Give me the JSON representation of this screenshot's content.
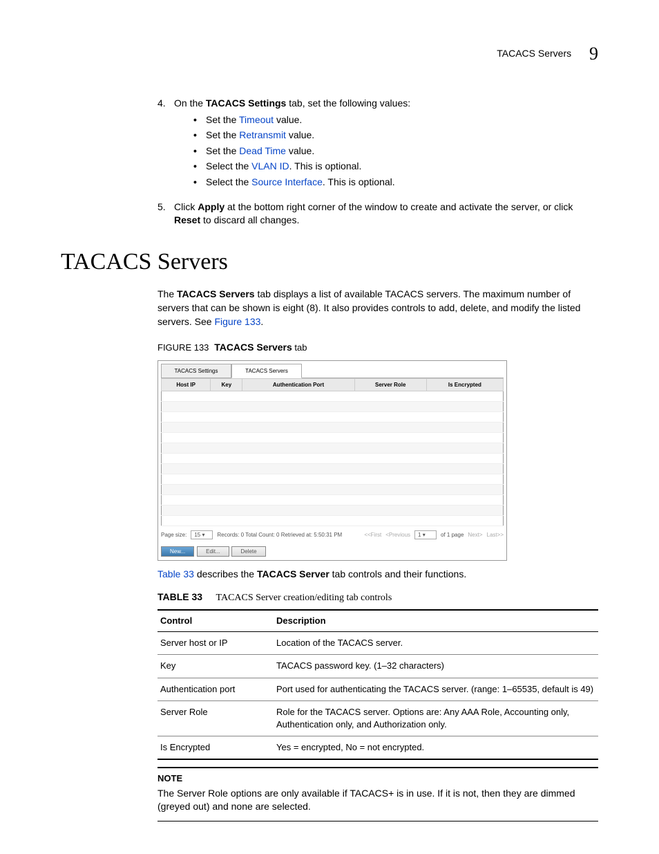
{
  "header": {
    "running_title": "TACACS Servers",
    "chapter_number": "9"
  },
  "steps": [
    {
      "num": "4.",
      "intro_before": "On the ",
      "bold1": "TACACS Settings",
      "intro_after": " tab, set the following values:",
      "bullets": [
        {
          "pre": "Set the ",
          "link": "Timeout",
          "post": " value."
        },
        {
          "pre": "Set the ",
          "link": "Retransmit",
          "post": " value."
        },
        {
          "pre": "Set the ",
          "link": "Dead Time",
          "post": " value."
        },
        {
          "pre": "Select the ",
          "link": "VLAN ID",
          "post": ". This is optional."
        },
        {
          "pre": "Select the ",
          "link": "Source Interface",
          "post": ". This is optional."
        }
      ]
    },
    {
      "num": "5.",
      "text_parts": [
        "Click ",
        "Apply",
        " at the bottom right corner of the window to create and activate the server, or click ",
        "Reset",
        " to discard all changes."
      ]
    }
  ],
  "section_title": "TACACS Servers",
  "intro_para": {
    "pre": "The ",
    "bold": "TACACS Servers",
    "mid": " tab displays a list of available TACACS servers. The maximum number of servers that can be shown is eight (8). It also provides controls to add, delete, and modify the listed servers. See ",
    "link": "Figure 133",
    "post": "."
  },
  "figure": {
    "label": "FIGURE 133",
    "title": "TACACS Servers",
    "title_suffix": " tab",
    "tabs": [
      "TACACS Settings",
      "TACACS Servers"
    ],
    "columns": [
      "Host IP",
      "Key",
      "Authentication Port",
      "Server Role",
      "Is Encrypted"
    ],
    "pager": {
      "page_size_label": "Page size:",
      "page_size_value": "15",
      "records": "Records: 0  Total Count: 0  Retrieved at: 5:50:31 PM",
      "first": "<<First",
      "prev": "<Previous",
      "page_input": "1",
      "of": "of 1 page",
      "next": "Next>",
      "last": "Last>>"
    },
    "buttons": {
      "new": "New...",
      "edit": "Edit...",
      "delete": "Delete"
    }
  },
  "after_figure": {
    "link": "Table 33",
    "pre": "",
    "mid": " describes the ",
    "bold": "TACACS Server",
    "post": " tab controls and their functions."
  },
  "table": {
    "label": "TABLE 33",
    "title": "TACACS Server creation/editing tab controls",
    "head": [
      "Control",
      "Description"
    ],
    "rows": [
      [
        "Server host or IP",
        "Location of the TACACS server."
      ],
      [
        "Key",
        "TACACS password key. (1–32 characters)"
      ],
      [
        "Authentication port",
        "Port used for authenticating the TACACS server. (range: 1–65535, default is 49)"
      ],
      [
        "Server Role",
        "Role for the TACACS server. Options are: Any AAA Role, Accounting only, Authentication only, and Authorization only."
      ],
      [
        "Is Encrypted",
        "Yes = encrypted, No = not encrypted."
      ]
    ]
  },
  "note": {
    "title": "NOTE",
    "body": "The Server Role options are only available if TACACS+ is in use. If it is not, then they are dimmed (greyed out) and none are selected."
  }
}
